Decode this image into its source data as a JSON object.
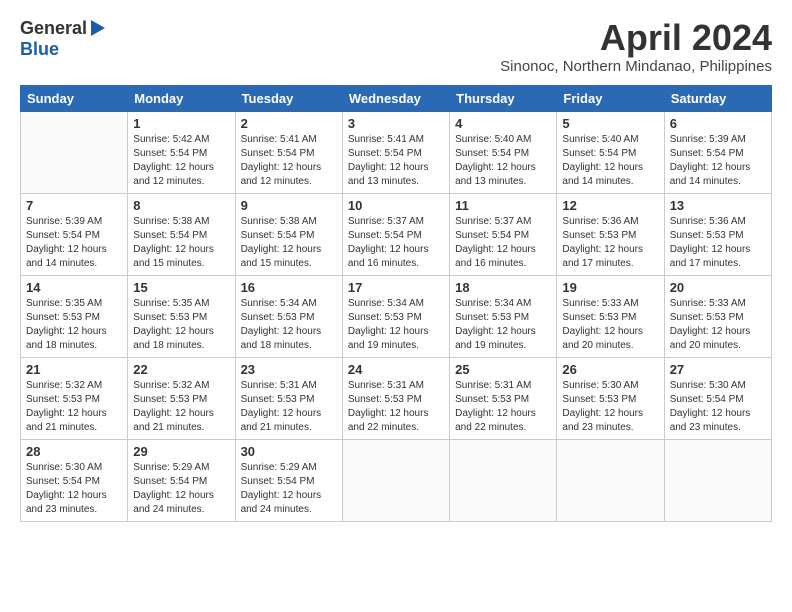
{
  "logo": {
    "general": "General",
    "blue": "Blue"
  },
  "title": "April 2024",
  "subtitle": "Sinonoc, Northern Mindanao, Philippines",
  "days": [
    "Sunday",
    "Monday",
    "Tuesday",
    "Wednesday",
    "Thursday",
    "Friday",
    "Saturday"
  ],
  "weeks": [
    [
      {
        "day": "",
        "sunrise": "",
        "sunset": "",
        "daylight": ""
      },
      {
        "day": "1",
        "sunrise": "Sunrise: 5:42 AM",
        "sunset": "Sunset: 5:54 PM",
        "daylight": "Daylight: 12 hours and 12 minutes."
      },
      {
        "day": "2",
        "sunrise": "Sunrise: 5:41 AM",
        "sunset": "Sunset: 5:54 PM",
        "daylight": "Daylight: 12 hours and 12 minutes."
      },
      {
        "day": "3",
        "sunrise": "Sunrise: 5:41 AM",
        "sunset": "Sunset: 5:54 PM",
        "daylight": "Daylight: 12 hours and 13 minutes."
      },
      {
        "day": "4",
        "sunrise": "Sunrise: 5:40 AM",
        "sunset": "Sunset: 5:54 PM",
        "daylight": "Daylight: 12 hours and 13 minutes."
      },
      {
        "day": "5",
        "sunrise": "Sunrise: 5:40 AM",
        "sunset": "Sunset: 5:54 PM",
        "daylight": "Daylight: 12 hours and 14 minutes."
      },
      {
        "day": "6",
        "sunrise": "Sunrise: 5:39 AM",
        "sunset": "Sunset: 5:54 PM",
        "daylight": "Daylight: 12 hours and 14 minutes."
      }
    ],
    [
      {
        "day": "7",
        "sunrise": "Sunrise: 5:39 AM",
        "sunset": "Sunset: 5:54 PM",
        "daylight": "Daylight: 12 hours and 14 minutes."
      },
      {
        "day": "8",
        "sunrise": "Sunrise: 5:38 AM",
        "sunset": "Sunset: 5:54 PM",
        "daylight": "Daylight: 12 hours and 15 minutes."
      },
      {
        "day": "9",
        "sunrise": "Sunrise: 5:38 AM",
        "sunset": "Sunset: 5:54 PM",
        "daylight": "Daylight: 12 hours and 15 minutes."
      },
      {
        "day": "10",
        "sunrise": "Sunrise: 5:37 AM",
        "sunset": "Sunset: 5:54 PM",
        "daylight": "Daylight: 12 hours and 16 minutes."
      },
      {
        "day": "11",
        "sunrise": "Sunrise: 5:37 AM",
        "sunset": "Sunset: 5:54 PM",
        "daylight": "Daylight: 12 hours and 16 minutes."
      },
      {
        "day": "12",
        "sunrise": "Sunrise: 5:36 AM",
        "sunset": "Sunset: 5:53 PM",
        "daylight": "Daylight: 12 hours and 17 minutes."
      },
      {
        "day": "13",
        "sunrise": "Sunrise: 5:36 AM",
        "sunset": "Sunset: 5:53 PM",
        "daylight": "Daylight: 12 hours and 17 minutes."
      }
    ],
    [
      {
        "day": "14",
        "sunrise": "Sunrise: 5:35 AM",
        "sunset": "Sunset: 5:53 PM",
        "daylight": "Daylight: 12 hours and 18 minutes."
      },
      {
        "day": "15",
        "sunrise": "Sunrise: 5:35 AM",
        "sunset": "Sunset: 5:53 PM",
        "daylight": "Daylight: 12 hours and 18 minutes."
      },
      {
        "day": "16",
        "sunrise": "Sunrise: 5:34 AM",
        "sunset": "Sunset: 5:53 PM",
        "daylight": "Daylight: 12 hours and 18 minutes."
      },
      {
        "day": "17",
        "sunrise": "Sunrise: 5:34 AM",
        "sunset": "Sunset: 5:53 PM",
        "daylight": "Daylight: 12 hours and 19 minutes."
      },
      {
        "day": "18",
        "sunrise": "Sunrise: 5:34 AM",
        "sunset": "Sunset: 5:53 PM",
        "daylight": "Daylight: 12 hours and 19 minutes."
      },
      {
        "day": "19",
        "sunrise": "Sunrise: 5:33 AM",
        "sunset": "Sunset: 5:53 PM",
        "daylight": "Daylight: 12 hours and 20 minutes."
      },
      {
        "day": "20",
        "sunrise": "Sunrise: 5:33 AM",
        "sunset": "Sunset: 5:53 PM",
        "daylight": "Daylight: 12 hours and 20 minutes."
      }
    ],
    [
      {
        "day": "21",
        "sunrise": "Sunrise: 5:32 AM",
        "sunset": "Sunset: 5:53 PM",
        "daylight": "Daylight: 12 hours and 21 minutes."
      },
      {
        "day": "22",
        "sunrise": "Sunrise: 5:32 AM",
        "sunset": "Sunset: 5:53 PM",
        "daylight": "Daylight: 12 hours and 21 minutes."
      },
      {
        "day": "23",
        "sunrise": "Sunrise: 5:31 AM",
        "sunset": "Sunset: 5:53 PM",
        "daylight": "Daylight: 12 hours and 21 minutes."
      },
      {
        "day": "24",
        "sunrise": "Sunrise: 5:31 AM",
        "sunset": "Sunset: 5:53 PM",
        "daylight": "Daylight: 12 hours and 22 minutes."
      },
      {
        "day": "25",
        "sunrise": "Sunrise: 5:31 AM",
        "sunset": "Sunset: 5:53 PM",
        "daylight": "Daylight: 12 hours and 22 minutes."
      },
      {
        "day": "26",
        "sunrise": "Sunrise: 5:30 AM",
        "sunset": "Sunset: 5:53 PM",
        "daylight": "Daylight: 12 hours and 23 minutes."
      },
      {
        "day": "27",
        "sunrise": "Sunrise: 5:30 AM",
        "sunset": "Sunset: 5:54 PM",
        "daylight": "Daylight: 12 hours and 23 minutes."
      }
    ],
    [
      {
        "day": "28",
        "sunrise": "Sunrise: 5:30 AM",
        "sunset": "Sunset: 5:54 PM",
        "daylight": "Daylight: 12 hours and 23 minutes."
      },
      {
        "day": "29",
        "sunrise": "Sunrise: 5:29 AM",
        "sunset": "Sunset: 5:54 PM",
        "daylight": "Daylight: 12 hours and 24 minutes."
      },
      {
        "day": "30",
        "sunrise": "Sunrise: 5:29 AM",
        "sunset": "Sunset: 5:54 PM",
        "daylight": "Daylight: 12 hours and 24 minutes."
      },
      {
        "day": "",
        "sunrise": "",
        "sunset": "",
        "daylight": ""
      },
      {
        "day": "",
        "sunrise": "",
        "sunset": "",
        "daylight": ""
      },
      {
        "day": "",
        "sunrise": "",
        "sunset": "",
        "daylight": ""
      },
      {
        "day": "",
        "sunrise": "",
        "sunset": "",
        "daylight": ""
      }
    ]
  ]
}
